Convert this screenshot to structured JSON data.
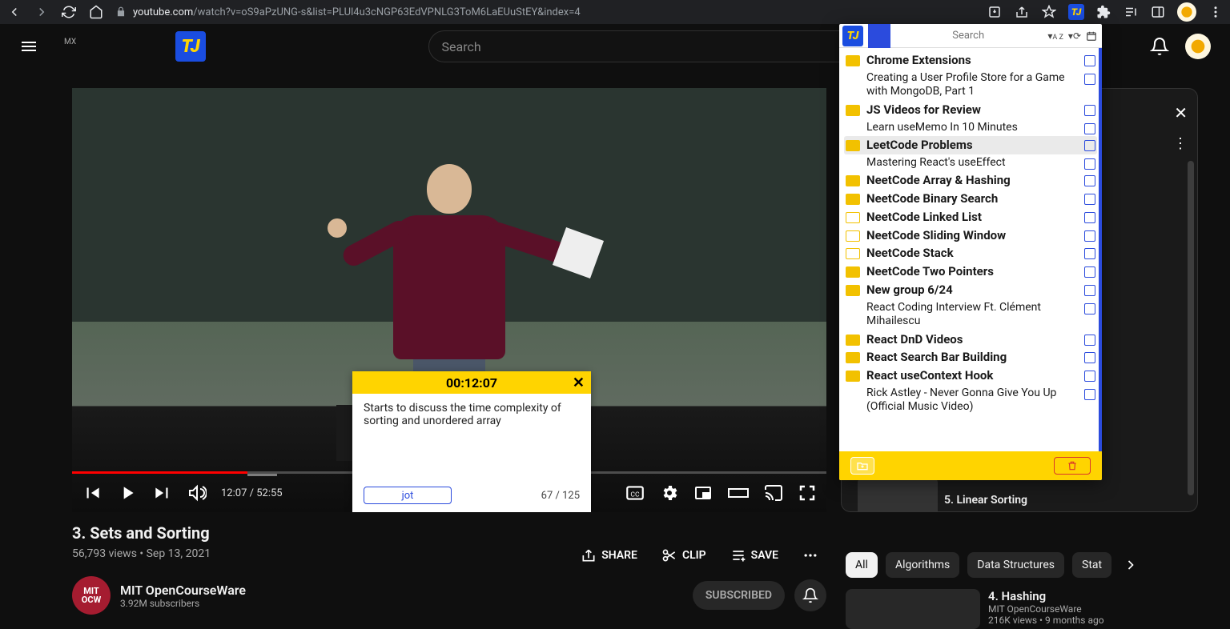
{
  "browser": {
    "url_prefix": "youtube.com",
    "url_rest": "/watch?v=oS9aPzUNG-s&list=PLUl4u3cNGP63EdVPNLG3ToM6LaEUuStEY&index=4"
  },
  "header": {
    "country": "MX",
    "search_placeholder": "Search"
  },
  "video": {
    "title": "3. Sets and Sorting",
    "views": "56,793 views",
    "date": "Sep 13, 2021",
    "time_current": "12:07",
    "time_total": "52:55",
    "actions": {
      "share": "SHARE",
      "clip": "CLIP",
      "save": "SAVE"
    }
  },
  "channel": {
    "name": "MIT OpenCourseWare",
    "subs": "3.92M subscribers",
    "subscribed_label": "SUBSCRIBED",
    "badge_top": "MIT",
    "badge_bottom": "OCW"
  },
  "note": {
    "timestamp": "00:12:07",
    "text": "Starts to discuss the time complexity of sorting and unordered array",
    "jot_label": "jot",
    "counter": "67 / 125"
  },
  "playlist": {
    "visible_item_title": "5. Linear Sorting"
  },
  "chips": [
    "All",
    "Algorithms",
    "Data Structures",
    "Stat"
  ],
  "recommendation": {
    "title": "4. Hashing",
    "channel": "MIT OpenCourseWare",
    "meta": "216K views • 9 months ago"
  },
  "extension": {
    "search_placeholder": "Search",
    "sort_label": "A Z",
    "rows": [
      {
        "type": "folder",
        "style": "solid",
        "text": "Chrome Extensions"
      },
      {
        "type": "item",
        "text": "Creating a User Profile Store for a Game with MongoDB, Part 1"
      },
      {
        "type": "folder",
        "style": "solid",
        "text": "JS Videos for Review"
      },
      {
        "type": "item",
        "text": "Learn useMemo In 10 Minutes"
      },
      {
        "type": "folder",
        "style": "solid",
        "text": "LeetCode Problems",
        "highlighted": true
      },
      {
        "type": "item",
        "text": "Mastering React's useEffect"
      },
      {
        "type": "folder",
        "style": "solid",
        "text": "NeetCode Array & Hashing"
      },
      {
        "type": "folder",
        "style": "solid",
        "text": "NeetCode Binary Search"
      },
      {
        "type": "folder",
        "style": "outline",
        "text": "NeetCode Linked List"
      },
      {
        "type": "folder",
        "style": "outline",
        "text": "NeetCode Sliding Window"
      },
      {
        "type": "folder",
        "style": "outline",
        "text": "NeetCode Stack"
      },
      {
        "type": "folder",
        "style": "solid",
        "text": "NeetCode Two Pointers"
      },
      {
        "type": "folder",
        "style": "solid",
        "text": "New group 6/24"
      },
      {
        "type": "item",
        "text": "React Coding Interview Ft. Clément Mihailescu"
      },
      {
        "type": "folder",
        "style": "solid",
        "text": "React DnD Videos"
      },
      {
        "type": "folder",
        "style": "solid",
        "text": "React Search Bar Building"
      },
      {
        "type": "folder",
        "style": "solid",
        "text": "React useContext Hook"
      },
      {
        "type": "item",
        "text": "Rick Astley - Never Gonna Give You Up (Official Music Video)"
      }
    ]
  }
}
